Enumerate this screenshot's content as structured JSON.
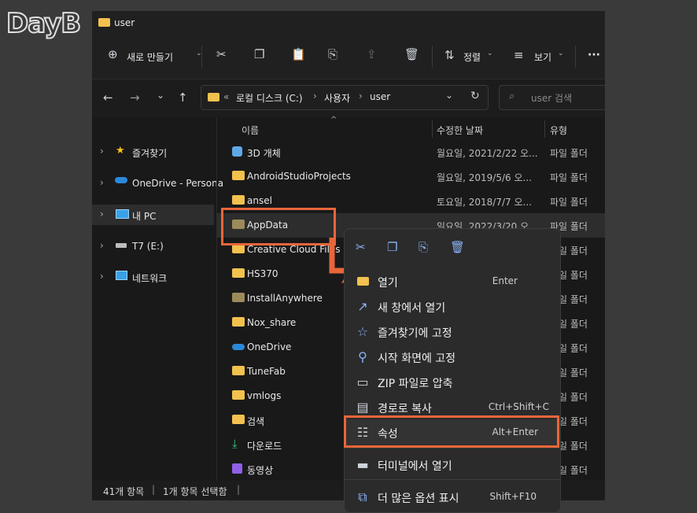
{
  "logo": "DayB",
  "window": {
    "title": "user"
  },
  "toolbar": {
    "new_label": "새로 만들기",
    "sort_label": "정렬",
    "view_label": "보기",
    "more_label": "···"
  },
  "address": {
    "prefix": "«",
    "parts": [
      "로컬 디스크 (C:)",
      "사용자",
      "user"
    ],
    "sep": "›"
  },
  "search": {
    "placeholder": "user 검색"
  },
  "sidebar": {
    "items": [
      {
        "label": "즐겨찾기",
        "icon": "star-icon"
      },
      {
        "label": "OneDrive - Persona",
        "icon": "cloud-icon"
      },
      {
        "label": "내 PC",
        "icon": "pc-icon"
      },
      {
        "label": "T7 (E:)",
        "icon": "drive-icon"
      },
      {
        "label": "네트워크",
        "icon": "network-icon"
      }
    ]
  },
  "columns": {
    "name": "이름",
    "modified": "수정한 날짜",
    "type": "유형"
  },
  "files": [
    {
      "name": "3D 개체",
      "date": "월요일, 2021/2/22 오...",
      "type": "파일 폴더"
    },
    {
      "name": "AndroidStudioProjects",
      "date": "월요일, 2019/5/6 오...",
      "type": "파일 폴더"
    },
    {
      "name": "ansel",
      "date": "토요일, 2018/7/7 오...",
      "type": "파일 폴더"
    },
    {
      "name": "AppData",
      "date": "일요일, 2022/3/20 오...",
      "type": "파일 폴더"
    },
    {
      "name": "Creative Cloud Files",
      "date": "",
      "type": "파일 폴더"
    },
    {
      "name": "HS370",
      "date": "",
      "type": "파일 폴더"
    },
    {
      "name": "InstallAnywhere",
      "date": "",
      "type": "파일 폴더"
    },
    {
      "name": "Nox_share",
      "date": "",
      "type": "파일 폴더"
    },
    {
      "name": "OneDrive",
      "date": "",
      "type": "파일 폴더"
    },
    {
      "name": "TuneFab",
      "date": "",
      "type": "파일 폴더"
    },
    {
      "name": "vmlogs",
      "date": "",
      "type": "파일 폴더"
    },
    {
      "name": "검색",
      "date": "",
      "type": "파일 폴더"
    },
    {
      "name": "다운로드",
      "date": "",
      "type": "파일 폴더"
    },
    {
      "name": "동영상",
      "date": "",
      "type": "파일 폴더"
    }
  ],
  "status": {
    "count": "41개 항목",
    "selected": "1개 항목 선택함"
  },
  "context_menu": {
    "items": [
      {
        "label": "열기",
        "shortcut": "Enter",
        "icon": "folder-open-icon"
      },
      {
        "label": "새 창에서 열기",
        "shortcut": "",
        "icon": "external-window-icon"
      },
      {
        "label": "즐겨찾기에 고정",
        "shortcut": "",
        "icon": "star-icon"
      },
      {
        "label": "시작 화면에 고정",
        "shortcut": "",
        "icon": "pin-icon"
      },
      {
        "label": "ZIP 파일로 압축",
        "shortcut": "",
        "icon": "zip-icon"
      },
      {
        "label": "경로로 복사",
        "shortcut": "Ctrl+Shift+C",
        "icon": "path-icon"
      },
      {
        "label": "속성",
        "shortcut": "Alt+Enter",
        "icon": "properties-icon"
      },
      {
        "label": "터미널에서 열기",
        "shortcut": "",
        "icon": "terminal-icon"
      },
      {
        "label": "더 많은 옵션 표시",
        "shortcut": "Shift+F10",
        "icon": "more-options-icon"
      }
    ]
  },
  "colors": {
    "accent": "#e8663a",
    "folder": "#f2c14e"
  }
}
